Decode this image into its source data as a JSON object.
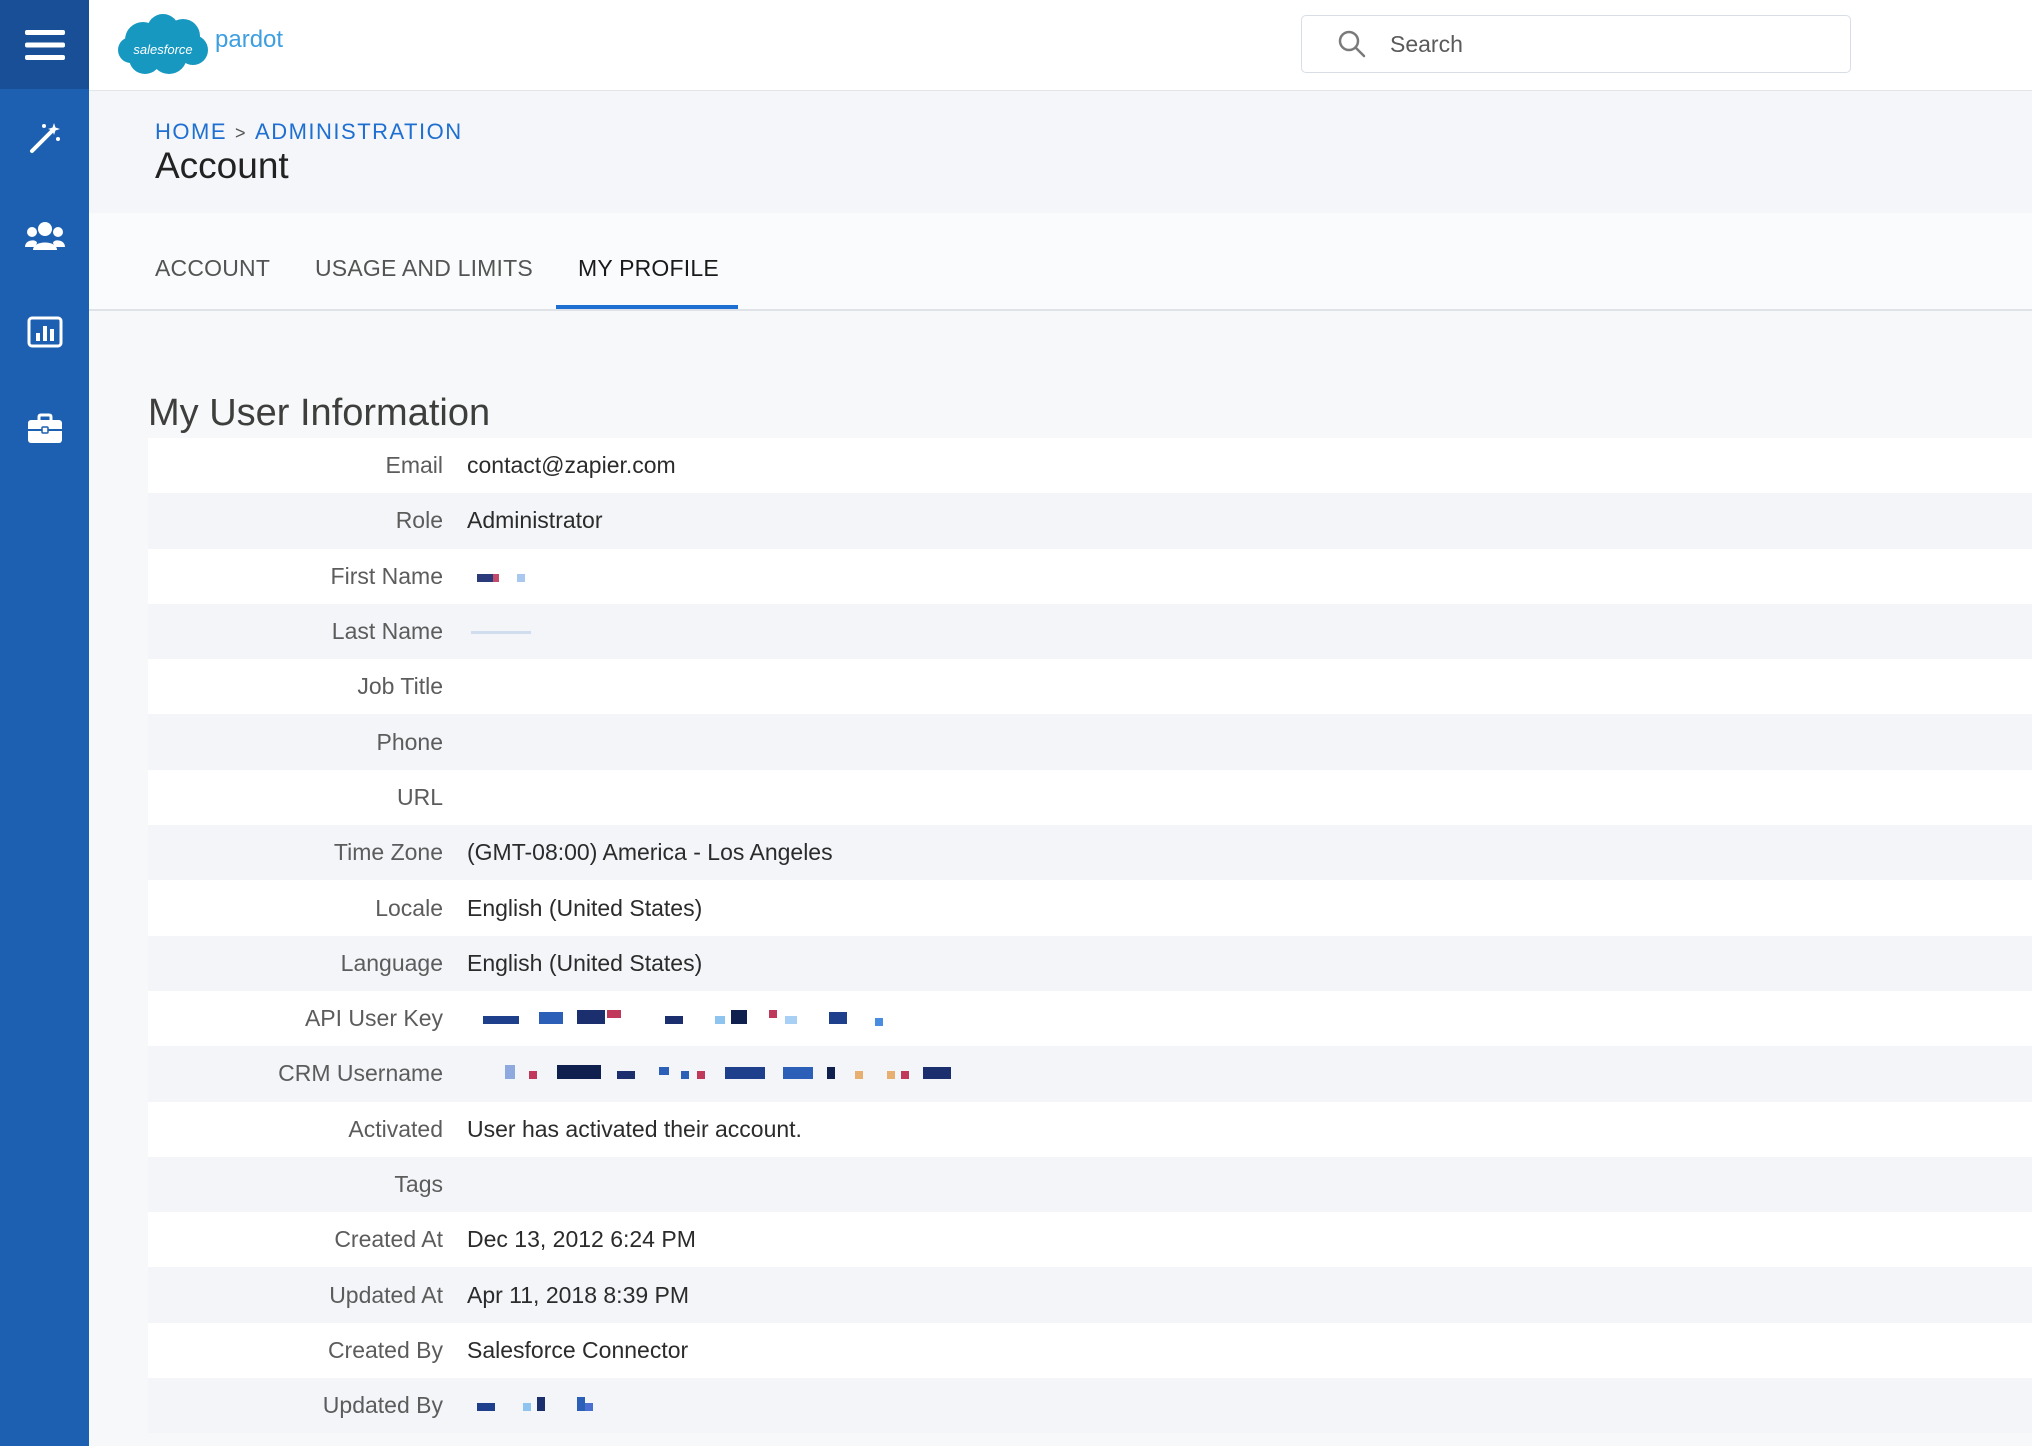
{
  "app": {
    "brand_main": "salesforce",
    "brand_sub": "pardot"
  },
  "search": {
    "placeholder": "Search"
  },
  "breadcrumb": {
    "home": "HOME",
    "separator": ">",
    "admin": "ADMINISTRATION"
  },
  "page": {
    "title": "Account"
  },
  "tabs": [
    {
      "label": "ACCOUNT",
      "active": false
    },
    {
      "label": "USAGE AND LIMITS",
      "active": false
    },
    {
      "label": "MY PROFILE",
      "active": true
    }
  ],
  "section": {
    "title": "My User Information"
  },
  "fields": [
    {
      "label": "Email",
      "value": "contact@zapier.com"
    },
    {
      "label": "Role",
      "value": "Administrator"
    },
    {
      "label": "First Name",
      "value": ""
    },
    {
      "label": "Last Name",
      "value": ""
    },
    {
      "label": "Job Title",
      "value": ""
    },
    {
      "label": "Phone",
      "value": ""
    },
    {
      "label": "URL",
      "value": ""
    },
    {
      "label": "Time Zone",
      "value": "(GMT-08:00) America - Los Angeles"
    },
    {
      "label": "Locale",
      "value": "English (United States)"
    },
    {
      "label": "Language",
      "value": "English (United States)"
    },
    {
      "label": "API User Key",
      "value": ""
    },
    {
      "label": "CRM Username",
      "value": ""
    },
    {
      "label": "Activated",
      "value": "User has activated their account."
    },
    {
      "label": "Tags",
      "value": ""
    },
    {
      "label": "Created At",
      "value": "Dec 13, 2012 6:24 PM"
    },
    {
      "label": "Updated At",
      "value": "Apr 11, 2018 8:39 PM"
    },
    {
      "label": "Created By",
      "value": "Salesforce Connector"
    },
    {
      "label": "Updated By",
      "value": ""
    }
  ],
  "colors": {
    "rail": "#1d5fb0",
    "accent": "#1e6fd1",
    "brand_cloud": "#1798c1"
  },
  "icons": [
    "menu-icon",
    "magic-wand-icon",
    "users-icon",
    "reports-icon",
    "briefcase-icon",
    "search-icon"
  ]
}
